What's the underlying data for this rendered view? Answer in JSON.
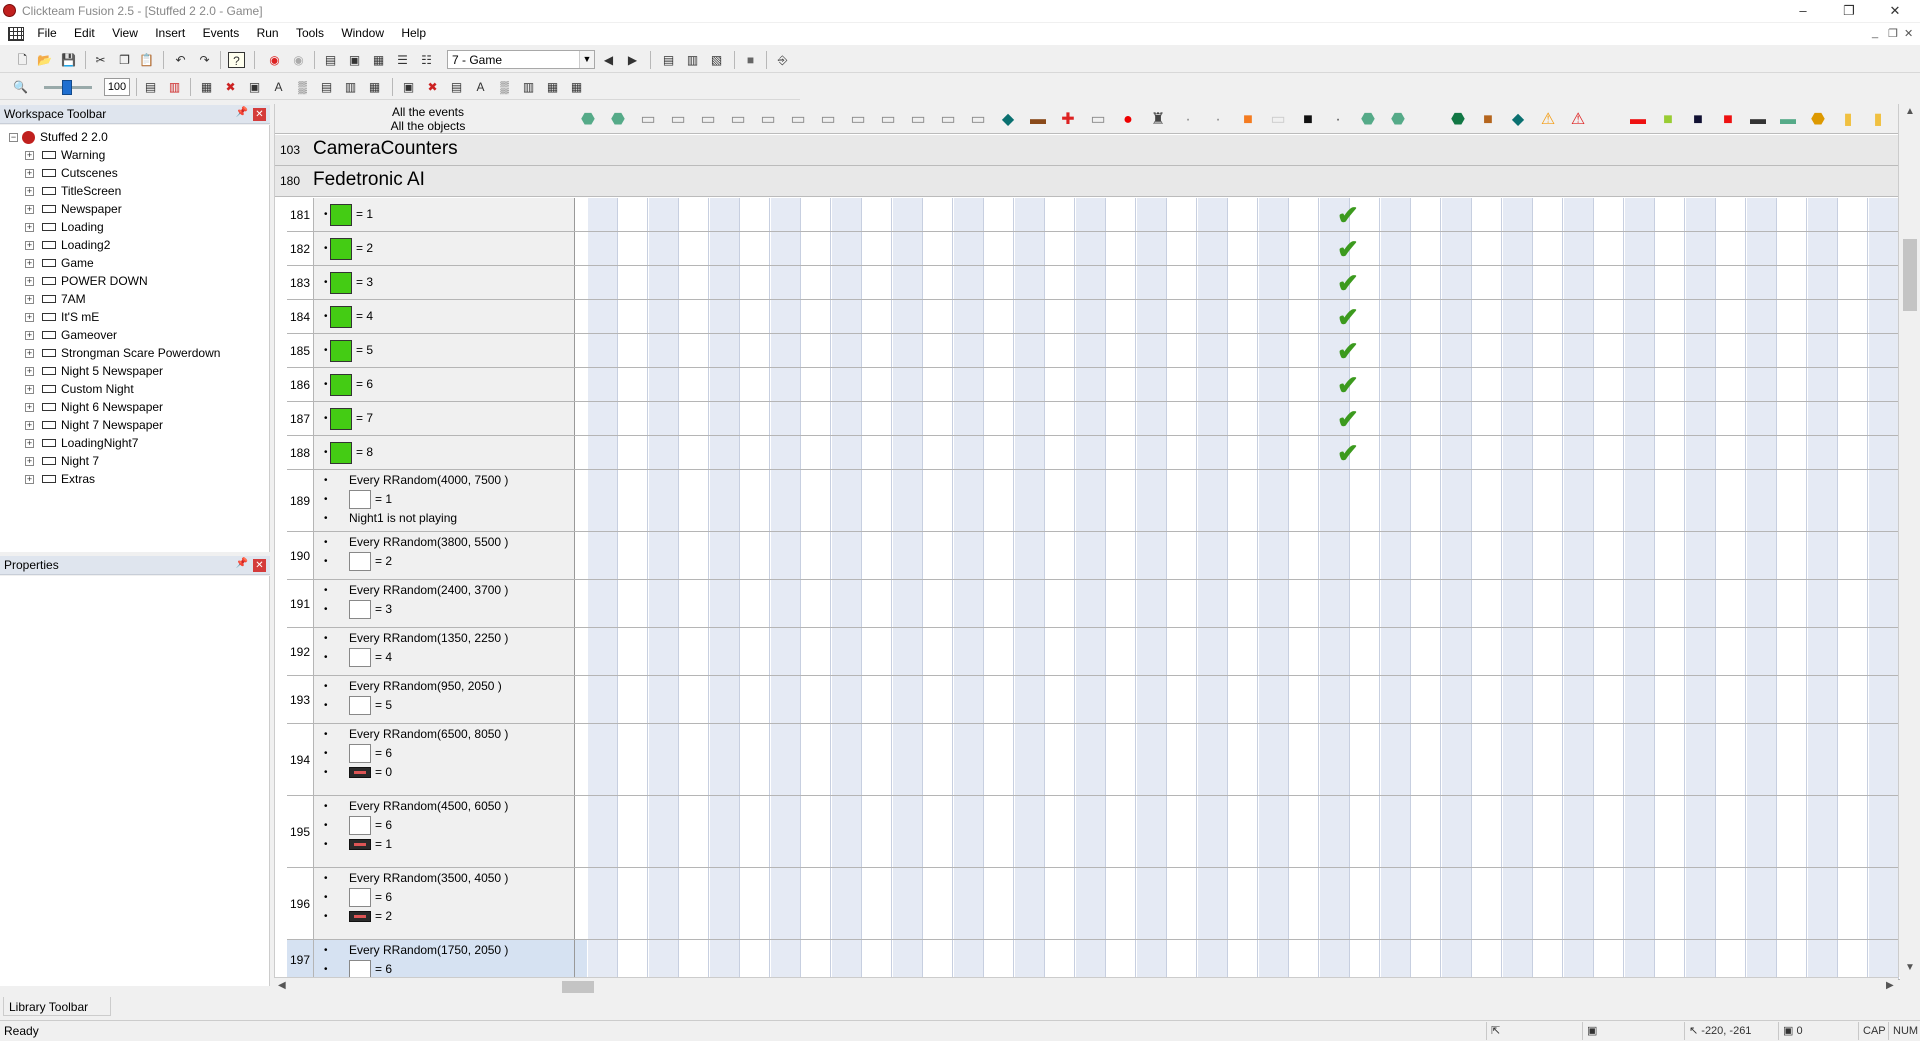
{
  "window": {
    "title": "Clickteam Fusion 2.5 - [Stuffed 2 2.0 - Game]"
  },
  "menu": [
    "File",
    "Edit",
    "View",
    "Insert",
    "Events",
    "Run",
    "Tools",
    "Window",
    "Help"
  ],
  "toolbar": {
    "frame_combo": "7 - Game",
    "zoom": "100"
  },
  "workspace": {
    "title": "Workspace Toolbar",
    "root": "Stuffed 2 2.0",
    "frames": [
      "Warning",
      "Cutscenes",
      "TitleScreen",
      "Newspaper",
      "Loading",
      "Loading2",
      "Game",
      "POWER DOWN",
      "7AM",
      "It'S mE",
      "Gameover",
      "Strongman Scare Powerdown",
      "Night 5 Newspaper",
      "Custom Night",
      "Night 6 Newspaper",
      "Night 7 Newspaper",
      "LoadingNight7",
      "Night 7",
      "Extras"
    ]
  },
  "properties": {
    "title": "Properties"
  },
  "library": {
    "title": "Library Toolbar"
  },
  "status": {
    "text": "Ready",
    "coords": "-220, -261",
    "zero": "0",
    "cap": "CAP",
    "num": "NUM"
  },
  "editor": {
    "header": {
      "line1": "All the events",
      "line2": "All the objects"
    },
    "groups": [
      {
        "num": "103",
        "name": "CameraCounters"
      },
      {
        "num": "180",
        "name": "Fedetronic AI"
      }
    ],
    "simple_events": [
      {
        "num": "181",
        "value": "= 1"
      },
      {
        "num": "182",
        "value": "= 2"
      },
      {
        "num": "183",
        "value": "= 3"
      },
      {
        "num": "184",
        "value": "= 4"
      },
      {
        "num": "185",
        "value": "= 5"
      },
      {
        "num": "186",
        "value": "= 6"
      },
      {
        "num": "187",
        "value": "= 7"
      },
      {
        "num": "188",
        "value": "= 8"
      }
    ],
    "ev189": {
      "num": "189",
      "l1": "Every RRandom(4000, 7500 )",
      "l2": "= 1",
      "l3": "Night1 is not playing"
    },
    "ev190": {
      "num": "190",
      "l1": "Every RRandom(3800, 5500 )",
      "l2": "= 2"
    },
    "ev191": {
      "num": "191",
      "l1": "Every RRandom(2400, 3700 )",
      "l2": "= 3"
    },
    "ev192": {
      "num": "192",
      "l1": "Every RRandom(1350, 2250 )",
      "l2": "= 4"
    },
    "ev193": {
      "num": "193",
      "l1": "Every RRandom(950, 2050 )",
      "l2": "= 5"
    },
    "ev194": {
      "num": "194",
      "l1": "Every RRandom(6500, 8050 )",
      "l2": "= 6",
      "l3": "= 0"
    },
    "ev195": {
      "num": "195",
      "l1": "Every RRandom(4500, 6050 )",
      "l2": "= 6",
      "l3": "= 1"
    },
    "ev196": {
      "num": "196",
      "l1": "Every RRandom(3500, 4050 )",
      "l2": "= 6",
      "l3": "= 2"
    },
    "ev197": {
      "num": "197",
      "l1": "Every RRandom(1750, 2050 )",
      "l2": "= 6"
    }
  },
  "colors": {
    "green_counter": "#44cc14",
    "check": "#3c9a1e",
    "header_blue": "#dfe5ee"
  }
}
